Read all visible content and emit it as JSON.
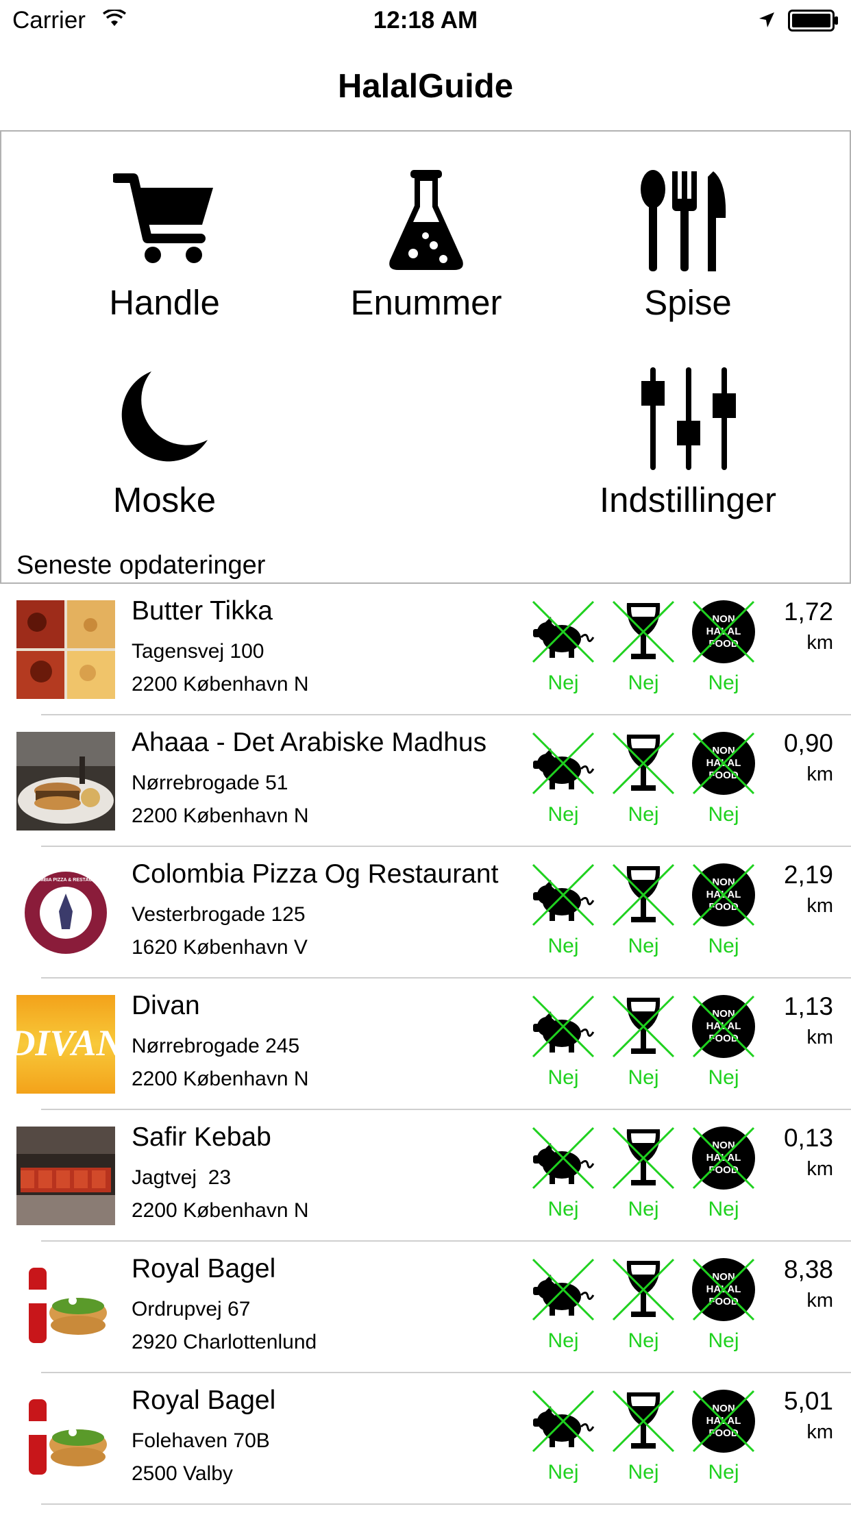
{
  "status_bar": {
    "carrier": "Carrier",
    "time": "12:18 AM"
  },
  "nav": {
    "title": "HalalGuide"
  },
  "menu": {
    "items": [
      {
        "label": "Handle",
        "icon": "shopping-cart-icon"
      },
      {
        "label": "Enummer",
        "icon": "flask-icon"
      },
      {
        "label": "Spise",
        "icon": "cutlery-icon"
      },
      {
        "label": "Moske",
        "icon": "crescent-moon-icon"
      },
      {
        "label": "Indstillinger",
        "icon": "sliders-icon"
      }
    ],
    "section_header": "Seneste opdateringer"
  },
  "badges": {
    "pork_label": "Nej",
    "alcohol_label": "Nej",
    "halal_label": "Nej",
    "halal_icon_text": "NON HALAL FOOD"
  },
  "colors": {
    "accent_green": "#1fd11f",
    "separator": "#cfcfcf"
  },
  "places": [
    {
      "name": "Butter Tikka",
      "address": "Tagensvej 100",
      "city": "2200 København N",
      "distance": "1,72",
      "unit": "km",
      "thumb": "food-photo"
    },
    {
      "name": "Ahaaa - Det Arabiske Madhus",
      "address": "Nørrebrogade 51",
      "city": "2200 København N",
      "distance": "0,90",
      "unit": "km",
      "thumb": "burger-photo"
    },
    {
      "name": "Colombia Pizza Og Restaurant",
      "address": "Vesterbrogade 125",
      "city": "1620 København V",
      "distance": "2,19",
      "unit": "km",
      "thumb": "restaurant-logo",
      "logo_text": "COLUMBIA PIZZA & RESTAURANT"
    },
    {
      "name": "Divan",
      "address": "Nørrebrogade 245",
      "city": "2200 København N",
      "distance": "1,13",
      "unit": "km",
      "thumb": "divan-logo",
      "logo_text": "DIVAN"
    },
    {
      "name": "Safir Kebab",
      "address": "Jagtvej  23",
      "city": "2200 København N",
      "distance": "0,13",
      "unit": "km",
      "thumb": "display-counter-photo"
    },
    {
      "name": "Royal Bagel",
      "address": "Ordrupvej 67",
      "city": "2920 Charlottenlund",
      "distance": "8,38",
      "unit": "km",
      "thumb": "bagel-photo"
    },
    {
      "name": "Royal Bagel",
      "address": "Folehaven 70B",
      "city": "2500 Valby",
      "distance": "5,01",
      "unit": "km",
      "thumb": "bagel-photo"
    }
  ]
}
